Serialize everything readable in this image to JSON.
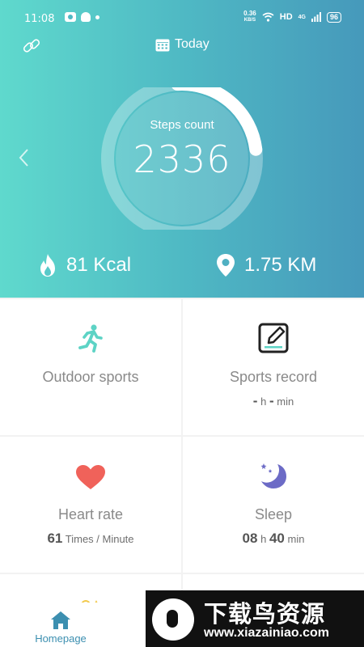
{
  "status_bar": {
    "time": "11:08",
    "net_speed_value": "0.36",
    "net_speed_unit": "KB/S",
    "hd": "HD",
    "signal": "4G",
    "battery": "96"
  },
  "header": {
    "title": "Today"
  },
  "steps": {
    "label": "Steps count",
    "value": "2336",
    "progress": 0.24
  },
  "stats": {
    "kcal": "81 Kcal",
    "distance": "1.75 KM"
  },
  "cards": {
    "outdoor": {
      "title": "Outdoor sports"
    },
    "record": {
      "title": "Sports record",
      "hours": "-",
      "h_unit": "h",
      "minutes": "-",
      "min_unit": "min"
    },
    "heart": {
      "title": "Heart rate",
      "value": "61",
      "unit": "Times / Minute"
    },
    "sleep": {
      "title": "Sleep",
      "hours": "08",
      "h_unit": "h",
      "minutes": "40",
      "min_unit": "min"
    }
  },
  "nav": {
    "home_label": "Homepage"
  },
  "watermark": {
    "name": "下载鸟资源",
    "url": "www.xiazainiao.com"
  },
  "colors": {
    "gradient_start": "#5fd9cd",
    "gradient_end": "#4699bb",
    "runner": "#5dd3c5",
    "heart": "#f0625a",
    "moon": "#6c6bc6",
    "nav_accent": "#3c8fb0"
  }
}
